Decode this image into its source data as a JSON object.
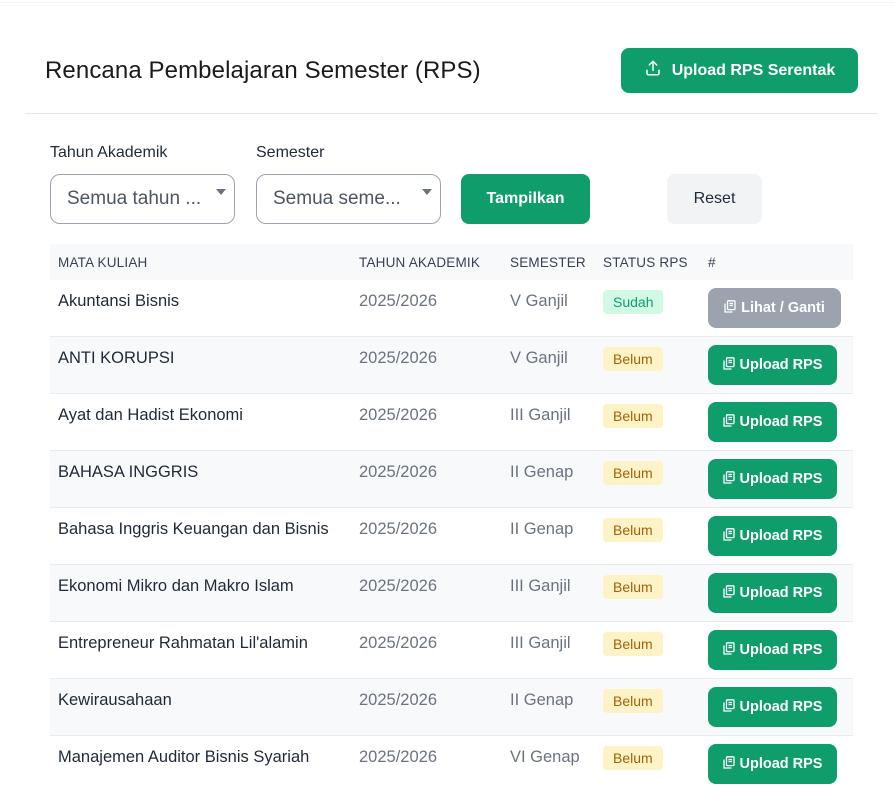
{
  "header": {
    "title": "Rencana Pembelajaran Semester (RPS)",
    "upload_all_label": "Upload RPS Serentak"
  },
  "filters": {
    "tahun_label": "Tahun Akademik",
    "tahun_value": "Semua tahun ...",
    "semester_label": "Semester",
    "semester_value": "Semua seme...",
    "submit_label": "Tampilkan",
    "reset_label": "Reset"
  },
  "table": {
    "columns": [
      "MATA KULIAH",
      "TAHUN AKADEMIK",
      "SEMESTER",
      "STATUS RPS",
      "#"
    ],
    "rows": [
      {
        "mata_kuliah": "Akuntansi Bisnis",
        "tahun": "2025/2026",
        "semester": "V Ganjil",
        "status": "Sudah",
        "action": "Lihat / Ganti"
      },
      {
        "mata_kuliah": "ANTI KORUPSI",
        "tahun": "2025/2026",
        "semester": "V Ganjil",
        "status": "Belum",
        "action": "Upload RPS"
      },
      {
        "mata_kuliah": "Ayat dan Hadist Ekonomi",
        "tahun": "2025/2026",
        "semester": "III Ganjil",
        "status": "Belum",
        "action": "Upload RPS"
      },
      {
        "mata_kuliah": "BAHASA INGGRIS",
        "tahun": "2025/2026",
        "semester": "II Genap",
        "status": "Belum",
        "action": "Upload RPS"
      },
      {
        "mata_kuliah": "Bahasa Inggris Keuangan dan Bisnis",
        "tahun": "2025/2026",
        "semester": "II Genap",
        "status": "Belum",
        "action": "Upload RPS"
      },
      {
        "mata_kuliah": "Ekonomi Mikro dan Makro Islam",
        "tahun": "2025/2026",
        "semester": "III Ganjil",
        "status": "Belum",
        "action": "Upload RPS"
      },
      {
        "mata_kuliah": "Entrepreneur Rahmatan Lil'alamin",
        "tahun": "2025/2026",
        "semester": "III Ganjil",
        "status": "Belum",
        "action": "Upload RPS"
      },
      {
        "mata_kuliah": "Kewirausahaan",
        "tahun": "2025/2026",
        "semester": "II Genap",
        "status": "Belum",
        "action": "Upload RPS"
      },
      {
        "mata_kuliah": "Manajemen Auditor Bisnis Syariah",
        "tahun": "2025/2026",
        "semester": "VI Genap",
        "status": "Belum",
        "action": "Upload RPS"
      }
    ]
  },
  "colors": {
    "primary": "#0f9d6b",
    "muted_button": "#9ca3af",
    "badge_sudah_bg": "#d1fae5",
    "badge_belum_bg": "#fef3c7"
  },
  "icons": {
    "upload_all": "upload-icon",
    "row_action": "copy-icon"
  }
}
